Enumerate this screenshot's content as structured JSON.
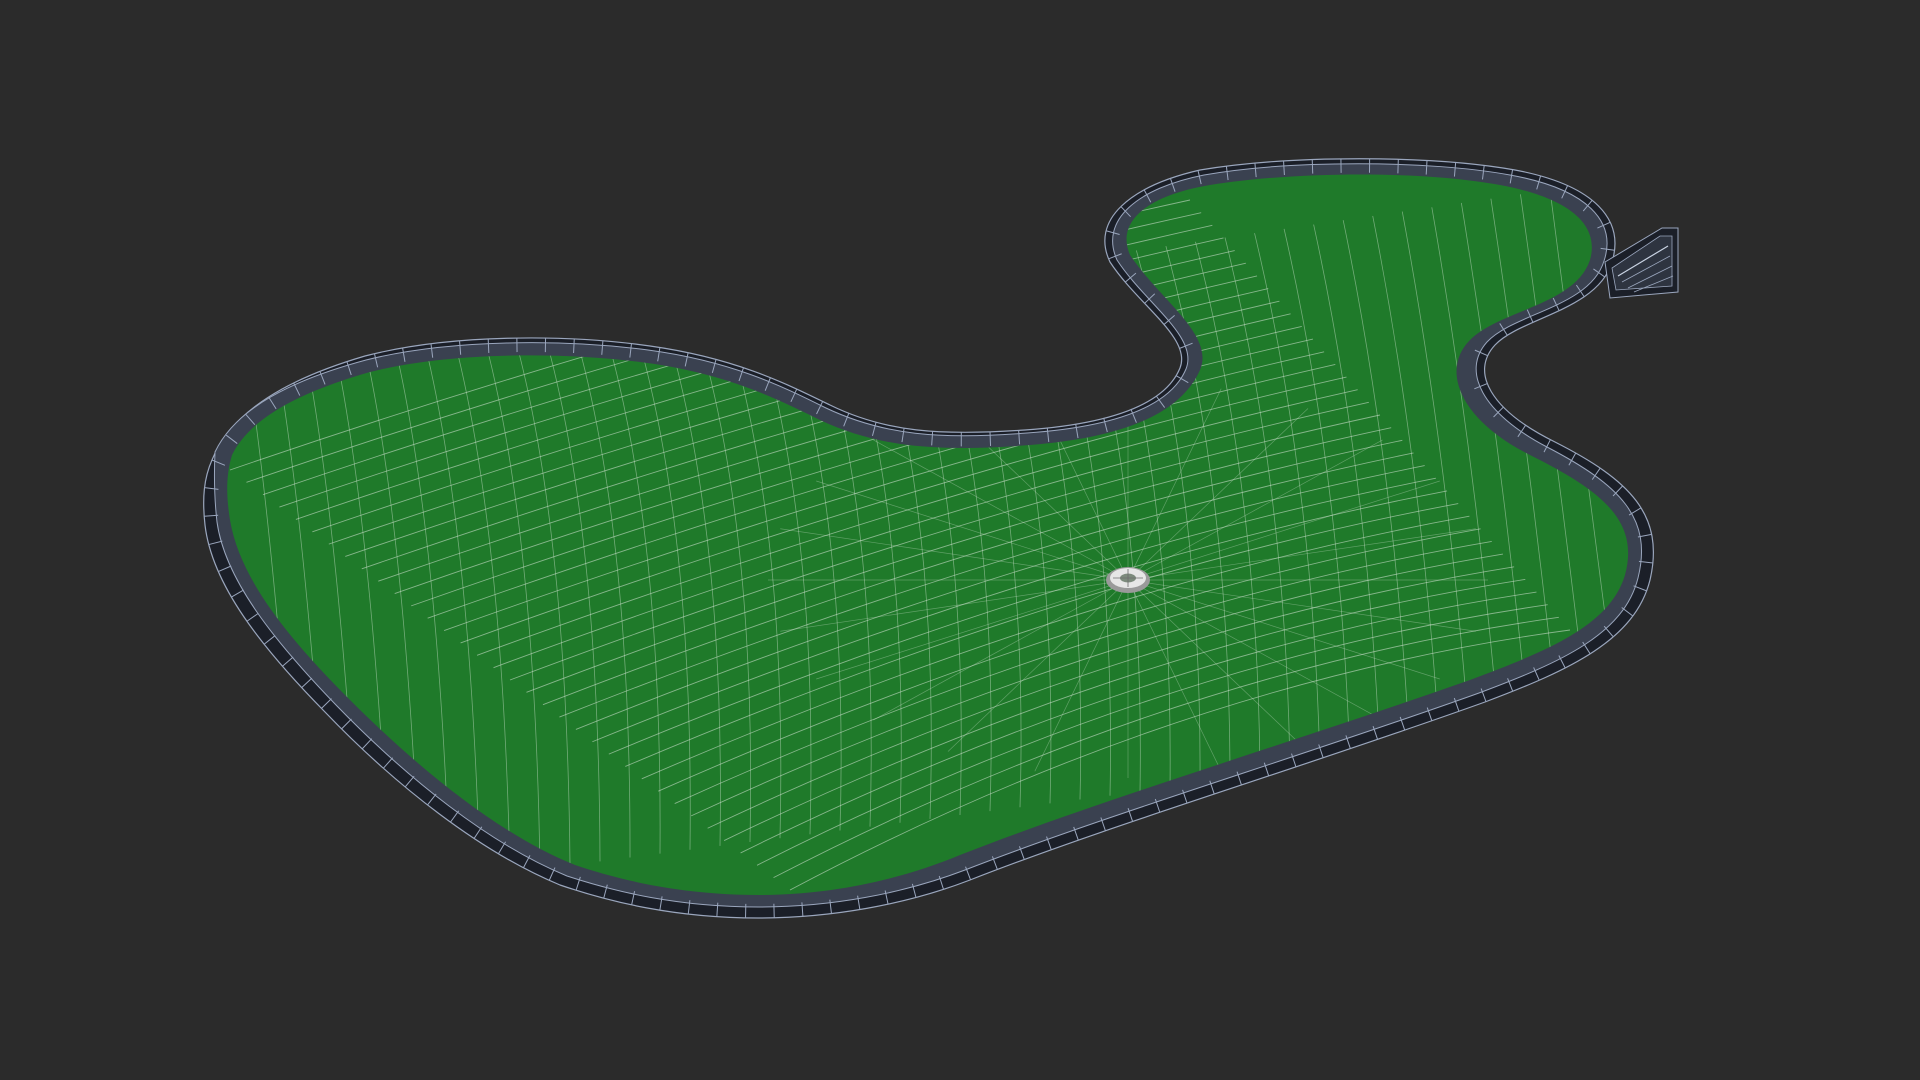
{
  "scene": {
    "subject": "mini-golf-green-wireframe",
    "colors": {
      "background": "#2b2b2b",
      "turf": "#1f7a2a",
      "turf_shade": "#176620",
      "wire": "#d8e8d8",
      "bumper_top": "#3a4150",
      "bumper_side": "#1b1f28",
      "bumper_wire": "#9aa6bd",
      "cup": "#e6e6e6",
      "cup_rim": "#9a9a9a"
    },
    "icons": {
      "cup": "golf-cup-icon"
    }
  }
}
